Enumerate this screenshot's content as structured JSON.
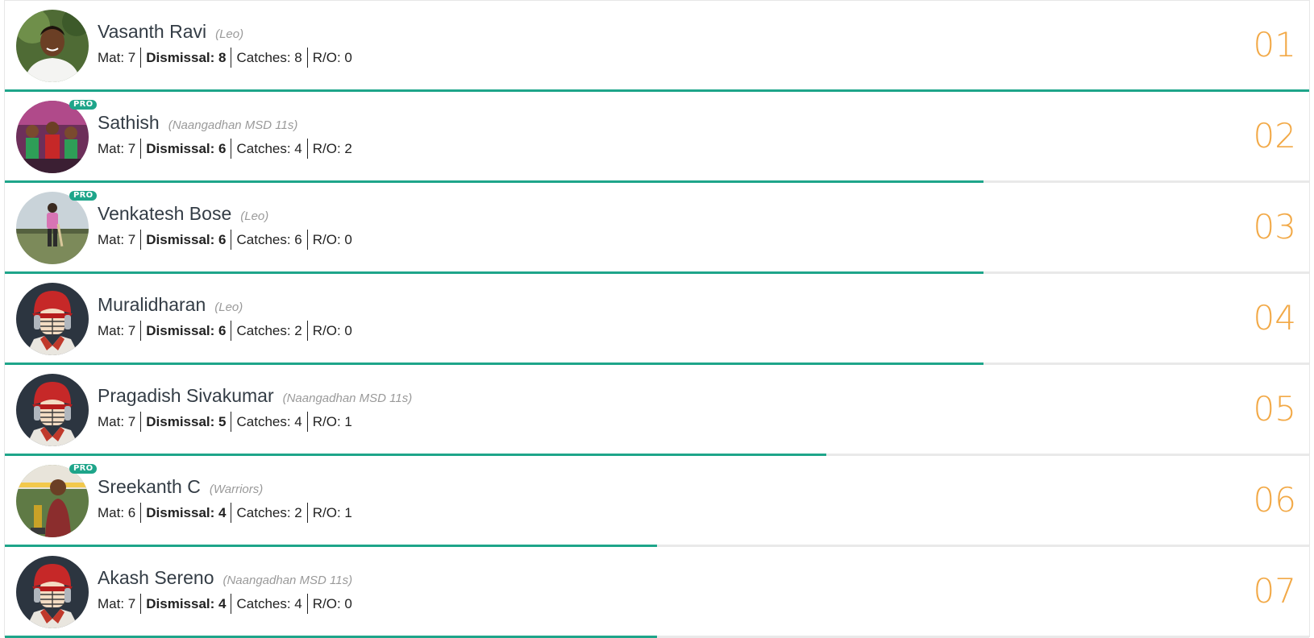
{
  "colors": {
    "accent": "#1ea58a",
    "rank": "#f2a947",
    "divider": "#e9e9e9"
  },
  "players": [
    {
      "name": "Vasanth Ravi",
      "team": "(Leo)",
      "pro": false,
      "avatar": "photo-man-white-shirt",
      "mat": "Mat: 7",
      "dismissal": "Dismissal: 8",
      "catches": "Catches: 8",
      "ro": "R/O: 0",
      "rank": "01",
      "progress": 1.0
    },
    {
      "name": "Sathish",
      "team": "(Naangadhan MSD 11s)",
      "pro": true,
      "pro_label": "PRO",
      "avatar": "photo-group",
      "mat": "Mat: 7",
      "dismissal": "Dismissal: 6",
      "catches": "Catches: 4",
      "ro": "R/O: 2",
      "rank": "02",
      "progress": 0.75
    },
    {
      "name": "Venkatesh Bose",
      "team": "(Leo)",
      "pro": true,
      "pro_label": "PRO",
      "avatar": "photo-field",
      "mat": "Mat: 7",
      "dismissal": "Dismissal: 6",
      "catches": "Catches: 6",
      "ro": "R/O: 0",
      "rank": "03",
      "progress": 0.75
    },
    {
      "name": "Muralidharan",
      "team": "(Leo)",
      "pro": false,
      "avatar": "helmet-placeholder",
      "mat": "Mat: 7",
      "dismissal": "Dismissal: 6",
      "catches": "Catches: 2",
      "ro": "R/O: 0",
      "rank": "04",
      "progress": 0.75
    },
    {
      "name": "Pragadish Sivakumar",
      "team": "(Naangadhan MSD 11s)",
      "pro": false,
      "avatar": "helmet-placeholder",
      "mat": "Mat: 7",
      "dismissal": "Dismissal: 5",
      "catches": "Catches: 4",
      "ro": "R/O: 1",
      "rank": "05",
      "progress": 0.63
    },
    {
      "name": "Sreekanth C",
      "team": "(Warriors)",
      "pro": true,
      "pro_label": "PRO",
      "avatar": "photo-trophy",
      "mat": "Mat: 6",
      "dismissal": "Dismissal: 4",
      "catches": "Catches: 2",
      "ro": "R/O: 1",
      "rank": "06",
      "progress": 0.5
    },
    {
      "name": "Akash Sereno",
      "team": "(Naangadhan MSD 11s)",
      "pro": false,
      "avatar": "helmet-placeholder",
      "mat": "Mat: 7",
      "dismissal": "Dismissal: 4",
      "catches": "Catches: 4",
      "ro": "R/O: 0",
      "rank": "07",
      "progress": 0.5
    }
  ]
}
